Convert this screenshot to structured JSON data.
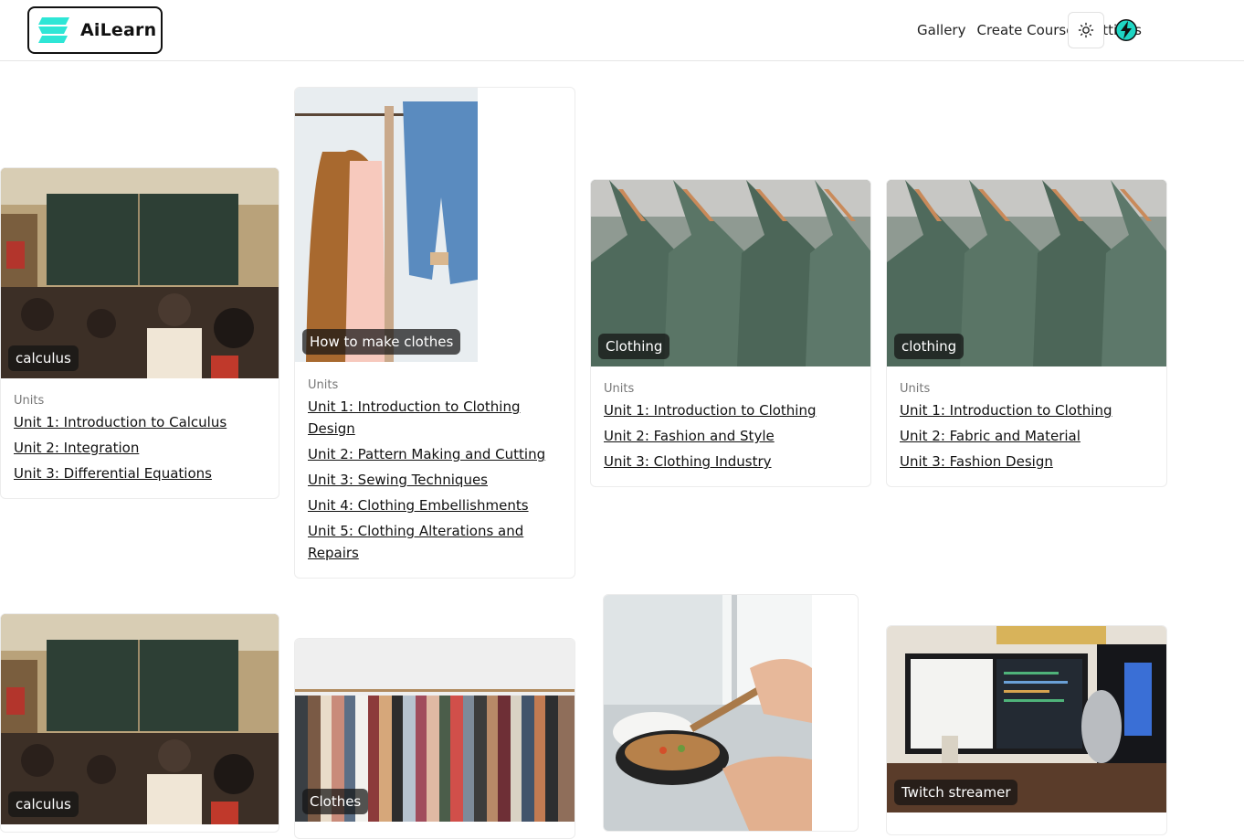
{
  "header": {
    "brand": "AiLearn",
    "nav": [
      "Gallery",
      "Create Course",
      "Settings"
    ]
  },
  "colors": {
    "accent": "#2ee6d6",
    "border": "#ececec"
  },
  "icons": {
    "theme": "sun-icon",
    "profile": "lightning-icon"
  },
  "cards": [
    {
      "tag": "calculus",
      "units_label": "Units",
      "units": [
        "Unit 1: Introduction to Calculus",
        "Unit 2: Integration",
        "Unit 3: Differential Equations"
      ]
    },
    {
      "tag": "How to make clothes",
      "units_label": "Units",
      "units": [
        "Unit 1: Introduction to Clothing Design",
        "Unit 2: Pattern Making and Cutting",
        "Unit 3: Sewing Techniques",
        "Unit 4: Clothing Embellishments",
        "Unit 5: Clothing Alterations and Repairs"
      ]
    },
    {
      "tag": "Clothing",
      "units_label": "Units",
      "units": [
        "Unit 1: Introduction to Clothing",
        "Unit 2: Fashion and Style",
        "Unit 3: Clothing Industry"
      ]
    },
    {
      "tag": "clothing",
      "units_label": "Units",
      "units": [
        "Unit 1: Introduction to Clothing",
        "Unit 2: Fabric and Material",
        "Unit 3: Fashion Design"
      ]
    },
    {
      "tag": "calculus"
    },
    {
      "tag": "Clothes"
    },
    {
      "tag": ""
    },
    {
      "tag": "Twitch streamer"
    }
  ]
}
